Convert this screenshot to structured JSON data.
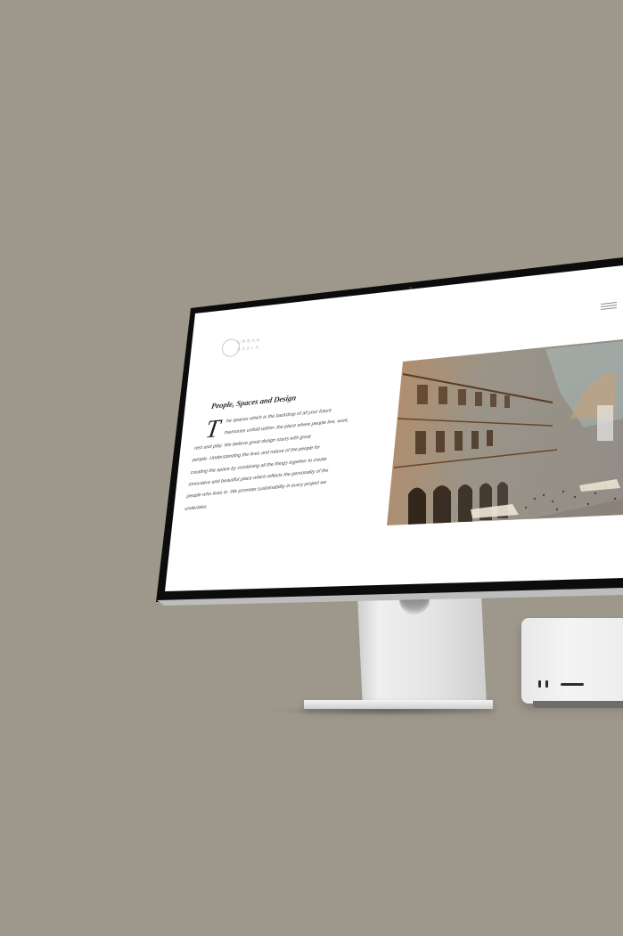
{
  "website": {
    "logo": {
      "line1": "URBAN",
      "line2": "ASALA"
    },
    "menu_icon": "hamburger-icon",
    "section": {
      "heading": "People, Spaces and Design",
      "dropcap": "T",
      "lines": [
        "he spaces which is the backdrop of all your future",
        "memories unfold within- the place where people live, work,",
        "rest and play. We believe great design starts with great",
        "people. Understanding the lives and nature of the people for",
        "creating the space by combining all the things together to create",
        "innovative and beautiful place which reflects the personality of the",
        "people who lives in. We promote sustainability in every project we",
        "undertake."
      ]
    }
  },
  "colors": {
    "background": "#9e978b",
    "bezel": "#0c0c0c",
    "screen": "#ffffff"
  }
}
